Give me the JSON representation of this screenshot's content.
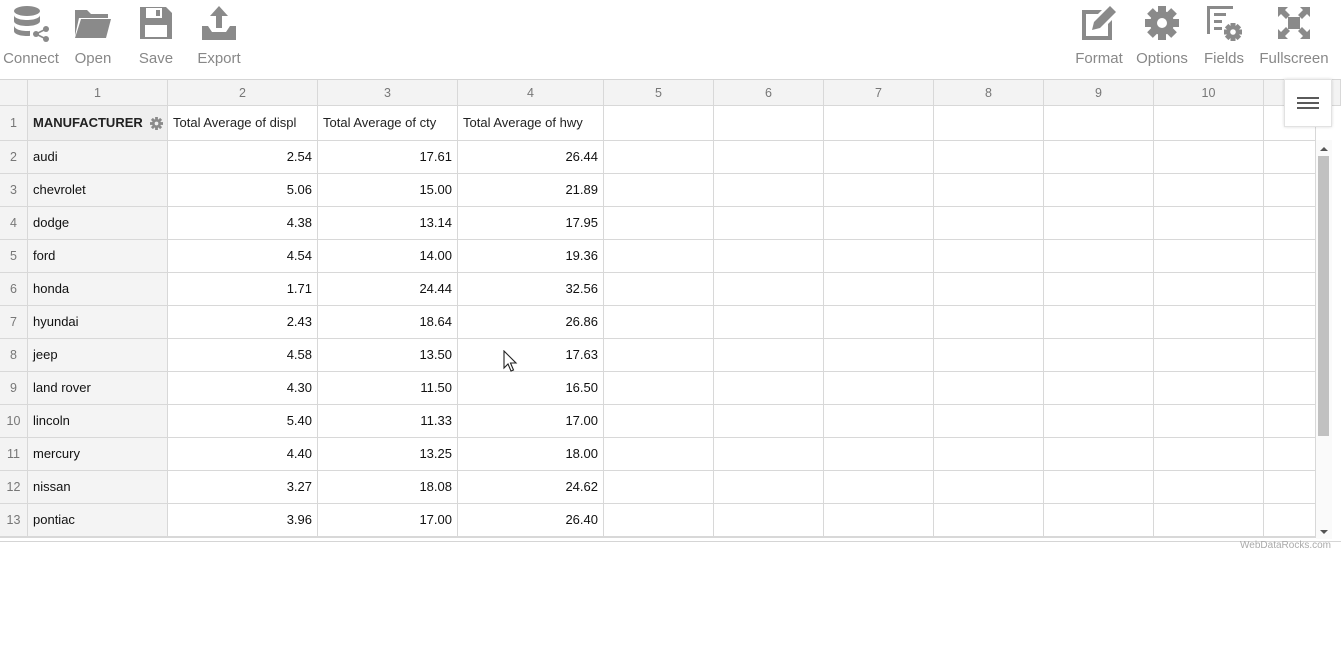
{
  "toolbar": {
    "left": [
      {
        "label": "Connect",
        "icon": "connect-icon"
      },
      {
        "label": "Open",
        "icon": "folder-icon"
      },
      {
        "label": "Save",
        "icon": "save-icon"
      },
      {
        "label": "Export",
        "icon": "export-icon"
      }
    ],
    "right": [
      {
        "label": "Format",
        "icon": "format-icon"
      },
      {
        "label": "Options",
        "icon": "gear-icon"
      },
      {
        "label": "Fields",
        "icon": "fields-icon"
      },
      {
        "label": "Fullscreen",
        "icon": "fullscreen-icon"
      }
    ]
  },
  "grid": {
    "column_numbers": [
      "1",
      "2",
      "3",
      "4",
      "5",
      "6",
      "7",
      "8",
      "9",
      "10"
    ],
    "row_numbers": [
      "1",
      "2",
      "3",
      "4",
      "5",
      "6",
      "7",
      "8",
      "9",
      "10",
      "11",
      "12",
      "13"
    ],
    "headers": {
      "manufacturer": "MANUFACTURER",
      "displ": "Total Average of displ",
      "cty": "Total Average of cty",
      "hwy": "Total Average of hwy"
    },
    "rows": [
      {
        "manufacturer": "audi",
        "displ": "2.54",
        "cty": "17.61",
        "hwy": "26.44"
      },
      {
        "manufacturer": "chevrolet",
        "displ": "5.06",
        "cty": "15.00",
        "hwy": "21.89"
      },
      {
        "manufacturer": "dodge",
        "displ": "4.38",
        "cty": "13.14",
        "hwy": "17.95"
      },
      {
        "manufacturer": "ford",
        "displ": "4.54",
        "cty": "14.00",
        "hwy": "19.36"
      },
      {
        "manufacturer": "honda",
        "displ": "1.71",
        "cty": "24.44",
        "hwy": "32.56"
      },
      {
        "manufacturer": "hyundai",
        "displ": "2.43",
        "cty": "18.64",
        "hwy": "26.86"
      },
      {
        "manufacturer": "jeep",
        "displ": "4.58",
        "cty": "13.50",
        "hwy": "17.63"
      },
      {
        "manufacturer": "land rover",
        "displ": "4.30",
        "cty": "11.50",
        "hwy": "16.50"
      },
      {
        "manufacturer": "lincoln",
        "displ": "5.40",
        "cty": "11.33",
        "hwy": "17.00"
      },
      {
        "manufacturer": "mercury",
        "displ": "4.40",
        "cty": "13.25",
        "hwy": "18.00"
      },
      {
        "manufacturer": "nissan",
        "displ": "3.27",
        "cty": "18.08",
        "hwy": "24.62"
      },
      {
        "manufacturer": "pontiac",
        "displ": "3.96",
        "cty": "17.00",
        "hwy": "26.40"
      }
    ]
  },
  "credit": "WebDataRocks.com",
  "colors": {
    "icon": "#8a8a8a",
    "label": "#888888",
    "header_bg": "#f3f3f3",
    "grid_line": "#d8d8d8"
  }
}
